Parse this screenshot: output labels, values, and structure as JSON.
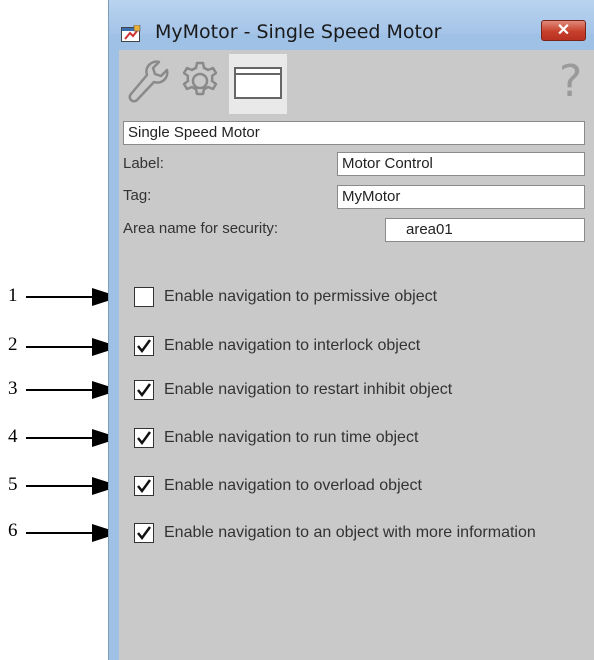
{
  "window": {
    "title": "MyMotor - Single Speed Motor",
    "close_label": "✕",
    "app_icon": "motor-faceplate-icon"
  },
  "toolbar": {
    "tabs": [
      {
        "icon": "wrench-icon"
      },
      {
        "icon": "gear-icon"
      },
      {
        "icon": "display-window-icon"
      }
    ],
    "help_label": "?"
  },
  "form": {
    "description_value": "Single Speed Motor",
    "label_label": "Label:",
    "label_value": "Motor Control",
    "tag_label": "Tag:",
    "tag_value": "MyMotor",
    "area_label": "Area name for security:",
    "area_value": "area01"
  },
  "checkboxes": [
    {
      "label": "Enable navigation to permissive object",
      "checked": false,
      "callout": "1"
    },
    {
      "label": "Enable navigation to interlock object",
      "checked": true,
      "callout": "2"
    },
    {
      "label": "Enable navigation to restart inhibit object",
      "checked": true,
      "callout": "3"
    },
    {
      "label": "Enable navigation to run time object",
      "checked": true,
      "callout": "4"
    },
    {
      "label": "Enable navigation to overload object",
      "checked": true,
      "callout": "5"
    },
    {
      "label": "Enable navigation to an object with more information",
      "checked": true,
      "callout": "6"
    }
  ],
  "colors": {
    "frame": "#9fc1e6",
    "panel": "#c9c9c9",
    "close": "#c7402c"
  }
}
